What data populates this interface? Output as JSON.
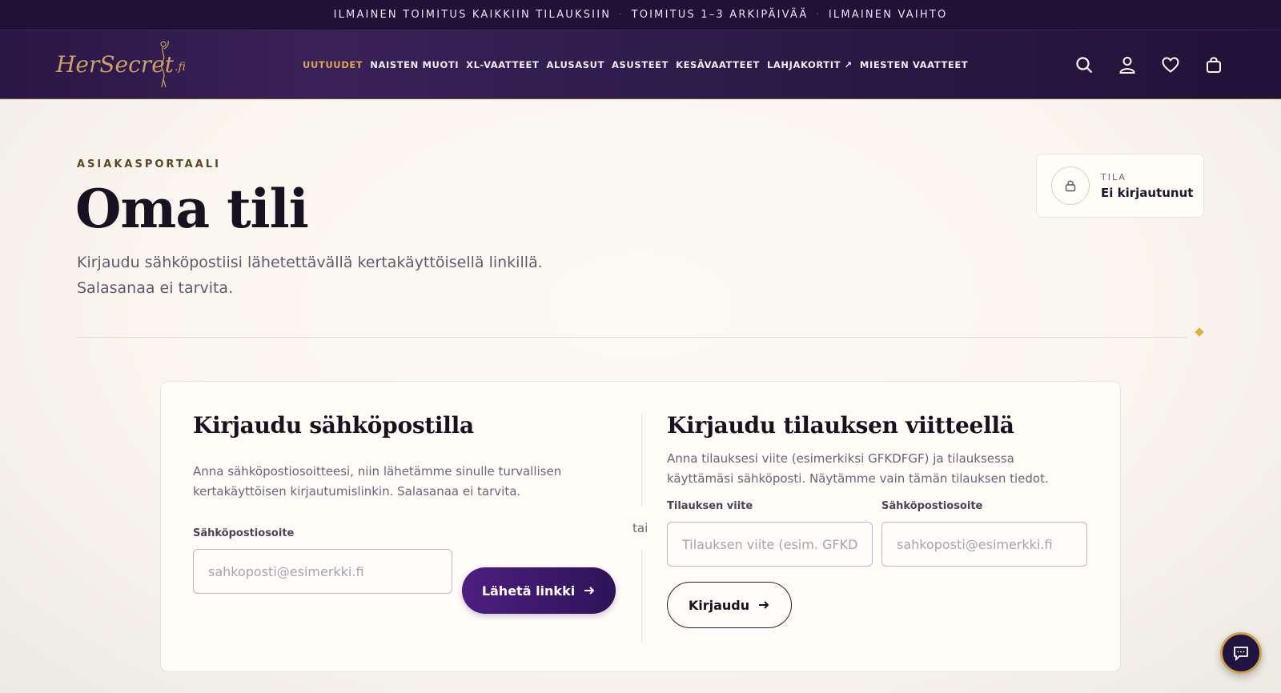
{
  "announcement": {
    "item1": "ILMAINEN TOIMITUS KAIKKIIN TILAUKSIIN",
    "item2": "TOIMITUS 1–3 ARKIPÄIVÄÄ",
    "item3": "ILMAINEN VAIHTO",
    "separator": "·"
  },
  "logo": {
    "text": "HerSecret",
    "suffix": ".fi"
  },
  "nav": {
    "items": [
      "UUTUUDET",
      "NAISTEN MUOTI",
      "XL-VAATTEET",
      "ALUSASUT",
      "ASUSTEET",
      "KESÄVAATTEET",
      "LAHJAKORTIT ↗",
      "MIESTEN VAATTEET"
    ]
  },
  "header_icons": [
    "search-icon",
    "user-icon",
    "heart-icon",
    "bag-icon"
  ],
  "page": {
    "eyebrow": "ASIAKASPORTAALI",
    "title": "Oma tili",
    "subtitle": "Kirjaudu sähköpostiisi lähetettävällä kertakäyttöisellä linkillä. Salasanaa ei tarvita."
  },
  "status": {
    "label": "TILA",
    "value": "Ei kirjautunut"
  },
  "email_login": {
    "heading": "Kirjaudu sähköpostilla",
    "description": "Anna sähköpostiosoitteesi, niin lähetämme sinulle turvallisen kertakäyttöisen kirjautumislinkin. Salasanaa ei tarvita.",
    "email_label": "Sähköpostiosoite",
    "email_placeholder": "sahkoposti@esimerkki.fi",
    "email_value": "",
    "submit_label": "Lähetä linkki"
  },
  "separator_text": "tai",
  "order_login": {
    "heading": "Kirjaudu tilauksen viitteellä",
    "description": "Anna tilauksesi viite (esimerkiksi GFKDFGF) ja tilauksessa käyttämäsi sähköposti. Näytämme vain tämän tilauksen tiedot.",
    "ref_label": "Tilauksen viite",
    "ref_placeholder": "Tilauksen viite (esim. GFKDFGF)",
    "ref_value": "",
    "email_label": "Sähköpostiosoite",
    "email_placeholder": "sahkoposti@esimerkki.fi",
    "email_value": "",
    "submit_label": "Kirjaudu"
  },
  "colors": {
    "accent_gold": "#d7a84f",
    "primary_purple": "#3d1a6c",
    "header_bg": "#2a1644"
  }
}
